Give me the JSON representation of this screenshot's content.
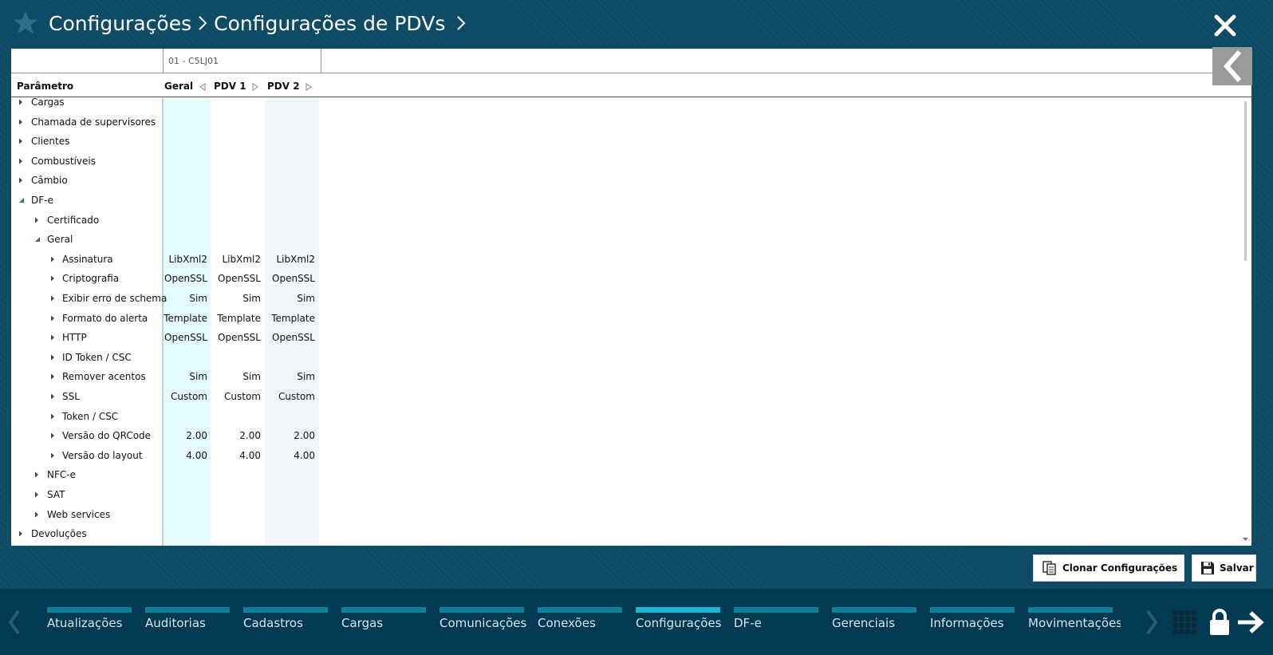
{
  "header": {
    "crumb1": "Configurações",
    "crumb2": "Configurações de PDVs",
    "star_icon": "star-icon",
    "close_icon": "close-icon"
  },
  "grid": {
    "store": "01 - C5LJ01",
    "param_header": "Parâmetro",
    "columns": [
      "Geral",
      "PDV 1",
      "PDV 2"
    ]
  },
  "tree": [
    {
      "label": "Cargas",
      "level": 0,
      "state": "collapsed",
      "values": [
        "",
        "",
        ""
      ]
    },
    {
      "label": "Chamada de supervisores",
      "level": 0,
      "state": "collapsed",
      "values": [
        "",
        "",
        ""
      ]
    },
    {
      "label": "Clientes",
      "level": 0,
      "state": "collapsed",
      "values": [
        "",
        "",
        ""
      ]
    },
    {
      "label": "Combustíveis",
      "level": 0,
      "state": "collapsed",
      "values": [
        "",
        "",
        ""
      ]
    },
    {
      "label": "Câmbio",
      "level": 0,
      "state": "collapsed",
      "values": [
        "",
        "",
        ""
      ]
    },
    {
      "label": "DF-e",
      "level": 0,
      "state": "expanded",
      "values": [
        "",
        "",
        ""
      ]
    },
    {
      "label": "Certificado",
      "level": 1,
      "state": "collapsed",
      "values": [
        "",
        "",
        ""
      ]
    },
    {
      "label": "Geral",
      "level": 1,
      "state": "expanded",
      "values": [
        "",
        "",
        ""
      ]
    },
    {
      "label": "Assinatura",
      "level": 2,
      "state": "collapsed",
      "values": [
        "LibXml2",
        "LibXml2",
        "LibXml2"
      ]
    },
    {
      "label": "Criptografia",
      "level": 2,
      "state": "collapsed",
      "values": [
        "OpenSSL",
        "OpenSSL",
        "OpenSSL"
      ]
    },
    {
      "label": "Exibir erro de schema",
      "level": 2,
      "state": "collapsed",
      "values": [
        "Sim",
        "Sim",
        "Sim"
      ]
    },
    {
      "label": "Formato do alerta",
      "level": 2,
      "state": "collapsed",
      "values": [
        "Template",
        "Template",
        "Template"
      ]
    },
    {
      "label": "HTTP",
      "level": 2,
      "state": "collapsed",
      "values": [
        "OpenSSL",
        "OpenSSL",
        "OpenSSL"
      ]
    },
    {
      "label": "ID Token / CSC",
      "level": 2,
      "state": "collapsed",
      "values": [
        "",
        "",
        ""
      ]
    },
    {
      "label": "Remover acentos",
      "level": 2,
      "state": "collapsed",
      "values": [
        "Sim",
        "Sim",
        "Sim"
      ]
    },
    {
      "label": "SSL",
      "level": 2,
      "state": "collapsed",
      "values": [
        "Custom",
        "Custom",
        "Custom"
      ]
    },
    {
      "label": "Token / CSC",
      "level": 2,
      "state": "collapsed",
      "values": [
        "",
        "",
        ""
      ]
    },
    {
      "label": "Versão do QRCode",
      "level": 2,
      "state": "collapsed",
      "values": [
        "2.00",
        "2.00",
        "2.00"
      ]
    },
    {
      "label": "Versão do layout",
      "level": 2,
      "state": "collapsed",
      "values": [
        "4.00",
        "4.00",
        "4.00"
      ]
    },
    {
      "label": "NFC-e",
      "level": 1,
      "state": "collapsed",
      "values": [
        "",
        "",
        ""
      ]
    },
    {
      "label": "SAT",
      "level": 1,
      "state": "collapsed",
      "values": [
        "",
        "",
        ""
      ]
    },
    {
      "label": "Web services",
      "level": 1,
      "state": "collapsed",
      "values": [
        "",
        "",
        ""
      ]
    },
    {
      "label": "Devoluções",
      "level": 0,
      "state": "collapsed",
      "values": [
        "",
        "",
        ""
      ]
    }
  ],
  "actions": {
    "clone_label": "Clonar Configurações",
    "save_label": "Salvar"
  },
  "nav": {
    "items": [
      "Atualizações",
      "Auditorias",
      "Cadastros",
      "Cargas",
      "Comunicações",
      "Conexões",
      "Configurações",
      "DF-e",
      "Gerenciais",
      "Informações",
      "Movimentações"
    ],
    "active": "Configurações"
  },
  "colors": {
    "background": "#0d4a64",
    "bottom_bar": "#013a52",
    "accent": "#19b6d8",
    "nav_bar": "#0f7f9a",
    "geral_column": "#e4fafc"
  }
}
